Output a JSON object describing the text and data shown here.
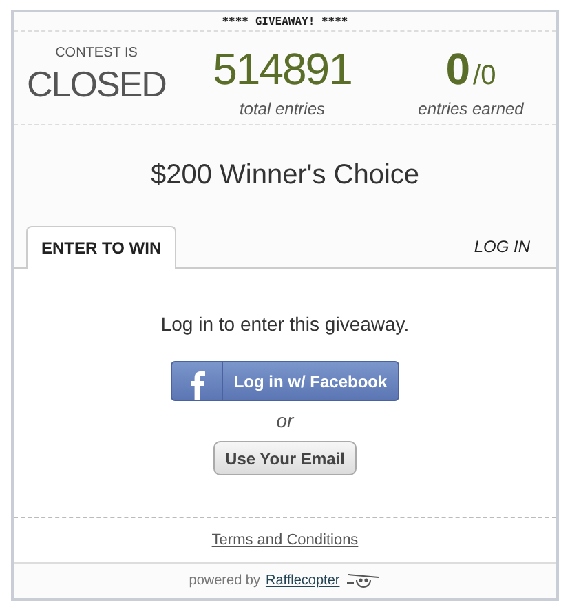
{
  "banner": "**** GIVEAWAY! ****",
  "status": {
    "label": "CONTEST IS",
    "value": "CLOSED"
  },
  "total": {
    "value": "514891",
    "label": "total entries"
  },
  "earned": {
    "value": "0",
    "of": "/0",
    "label": "entries earned"
  },
  "prize": "$200 Winner's Choice",
  "tabs": [
    {
      "label": "ENTER TO WIN",
      "selected": true
    },
    {
      "label": "LOG IN",
      "selected": false
    }
  ],
  "prompt": "Log in to enter this giveaway.",
  "facebook_button": "Log in w/ Facebook",
  "separator": "or",
  "email_button": "Use Your Email",
  "terms_link": "Terms and Conditions",
  "footer": {
    "text": "powered by",
    "link": "Rafflecopter"
  }
}
